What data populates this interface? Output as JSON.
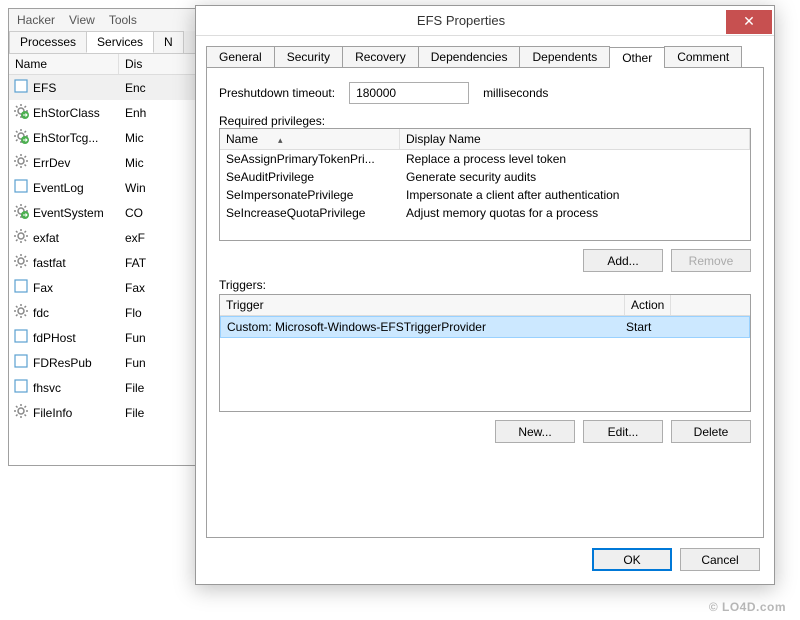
{
  "menu": {
    "hacker": "Hacker",
    "view": "View",
    "tools": "Tools"
  },
  "mainTabs": {
    "processes": "Processes",
    "services": "Services",
    "network": "N"
  },
  "listHeader": {
    "name": "Name",
    "desc": "Dis"
  },
  "services": [
    {
      "icon": "blank",
      "name": "EFS",
      "desc": "Enc",
      "sel": true
    },
    {
      "icon": "gear-go",
      "name": "EhStorClass",
      "desc": "Enh"
    },
    {
      "icon": "gear-go",
      "name": "EhStorTcg...",
      "desc": "Mic"
    },
    {
      "icon": "gear",
      "name": "ErrDev",
      "desc": "Mic"
    },
    {
      "icon": "blank",
      "name": "EventLog",
      "desc": "Win"
    },
    {
      "icon": "gear-go",
      "name": "EventSystem",
      "desc": "CO"
    },
    {
      "icon": "gear",
      "name": "exfat",
      "desc": "exF"
    },
    {
      "icon": "gear",
      "name": "fastfat",
      "desc": "FAT"
    },
    {
      "icon": "blank",
      "name": "Fax",
      "desc": "Fax"
    },
    {
      "icon": "gear",
      "name": "fdc",
      "desc": "Flo"
    },
    {
      "icon": "blank",
      "name": "fdPHost",
      "desc": "Fun"
    },
    {
      "icon": "blank",
      "name": "FDResPub",
      "desc": "Fun"
    },
    {
      "icon": "blank",
      "name": "fhsvc",
      "desc": "File"
    },
    {
      "icon": "gear",
      "name": "FileInfo",
      "desc": "File"
    }
  ],
  "dialog": {
    "title": "EFS Properties",
    "tabs": [
      "General",
      "Security",
      "Recovery",
      "Dependencies",
      "Dependents",
      "Other",
      "Comment"
    ],
    "activeTab": 5,
    "preshutdown": {
      "label": "Preshutdown timeout:",
      "value": "180000",
      "unit": "milliseconds"
    },
    "requiredLabel": "Required privileges:",
    "privHeader": {
      "name": "Name",
      "disp": "Display Name"
    },
    "privileges": [
      {
        "name": "SeAssignPrimaryTokenPri...",
        "disp": "Replace a process level token"
      },
      {
        "name": "SeAuditPrivilege",
        "disp": "Generate security audits"
      },
      {
        "name": "SeImpersonatePrivilege",
        "disp": "Impersonate a client after authentication"
      },
      {
        "name": "SeIncreaseQuotaPrivilege",
        "disp": "Adjust memory quotas for a process"
      }
    ],
    "addBtn": "Add...",
    "removeBtn": "Remove",
    "triggersLabel": "Triggers:",
    "trigHeader": {
      "trigger": "Trigger",
      "action": "Action"
    },
    "triggers": [
      {
        "trigger": "Custom: Microsoft-Windows-EFSTriggerProvider",
        "action": "Start"
      }
    ],
    "newBtn": "New...",
    "editBtn": "Edit...",
    "deleteBtn": "Delete",
    "okBtn": "OK",
    "cancelBtn": "Cancel"
  },
  "watermark": "© LO4D.com"
}
